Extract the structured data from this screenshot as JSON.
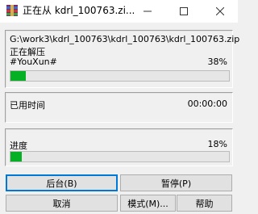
{
  "window": {
    "title": "正在从 kdrl_100763.zi...",
    "icons": {
      "app": "winrar-icon",
      "minimize": "minimize-icon",
      "maximize": "maximize-icon",
      "close": "close-icon"
    }
  },
  "extract": {
    "path": "G:\\work3\\kdrl_100763\\kdrl_100763\\kdrl_100763.zip",
    "status": "正在解压",
    "current_item": "#YouXun#",
    "file_percent_text": "38%",
    "file_progress": 0.07
  },
  "time": {
    "elapsed_label": "已用时间",
    "elapsed_value": "00:00:00"
  },
  "overall": {
    "label": "进度",
    "percent_text": "18%",
    "progress": 0.05
  },
  "buttons": {
    "background": "后台(B)",
    "pause": "暂停(P)",
    "cancel": "取消",
    "mode": "模式(M)...",
    "help": "帮助"
  },
  "colors": {
    "progress": "#06b025",
    "focus": "#0078d7"
  }
}
